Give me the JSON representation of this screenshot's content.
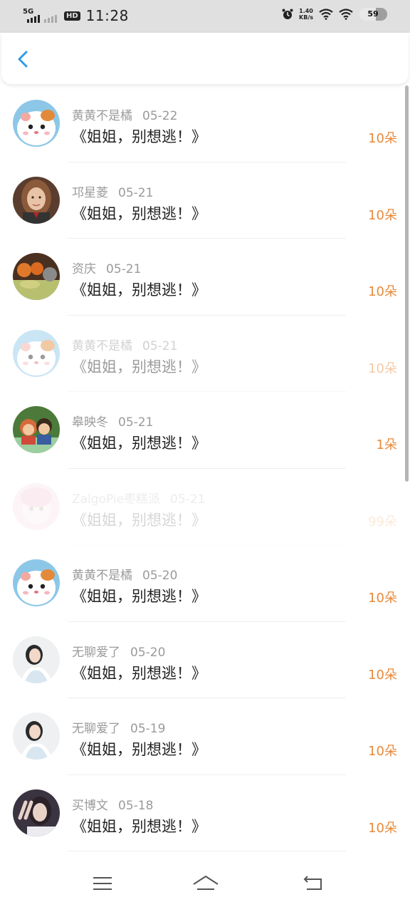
{
  "status_bar": {
    "network": "5G",
    "hd": "HD",
    "time": "11:28",
    "speed_value": "1.40",
    "speed_unit": "KB/s",
    "battery": "59",
    "battery_level": 0.59
  },
  "header": {
    "back_icon": "chevron-left-icon",
    "accent": "#2f9be8"
  },
  "records": [
    {
      "user": "黄黄不是橘",
      "date": "05-22",
      "title": "《姐姐，别想逃！》",
      "flowers": "10朵",
      "avatar": "hamster"
    },
    {
      "user": "邛星菱",
      "date": "05-21",
      "title": "《姐姐，别想逃！》",
      "flowers": "10朵",
      "avatar": "girl-brown-hair"
    },
    {
      "user": "资庆",
      "date": "05-21",
      "title": "《姐姐，别想逃！》",
      "flowers": "10朵",
      "avatar": "food-table"
    },
    {
      "user": "黄黄不是橘",
      "date": "05-21",
      "title": "《姐姐，别想逃！》",
      "flowers": "10朵",
      "avatar": "hamster"
    },
    {
      "user": "皋映冬",
      "date": "05-21",
      "title": "《姐姐，别想逃！》",
      "flowers": "1朵",
      "avatar": "cartoon-kids"
    },
    {
      "user": "ZalgoPie枣糕派",
      "date": "05-21",
      "title": "《姐姐，别想逃！》",
      "flowers": "99朵",
      "avatar": "pink-character"
    },
    {
      "user": "黄黄不是橘",
      "date": "05-20",
      "title": "《姐姐，别想逃！》",
      "flowers": "10朵",
      "avatar": "hamster"
    },
    {
      "user": "无聊爱了",
      "date": "05-20",
      "title": "《姐姐，别想逃！》",
      "flowers": "10朵",
      "avatar": "girl-white-dress"
    },
    {
      "user": "无聊爱了",
      "date": "05-19",
      "title": "《姐姐，别想逃！》",
      "flowers": "10朵",
      "avatar": "girl-white-dress"
    },
    {
      "user": "买博文",
      "date": "05-18",
      "title": "《姐姐，别想逃！》",
      "flowers": "10朵",
      "avatar": "person-peace-sign"
    }
  ],
  "colors": {
    "flowers": "#e8893a",
    "username": "#9a9a9a",
    "title": "#222222"
  },
  "nav": {
    "menu_icon": "menu-icon",
    "home_icon": "home-icon",
    "back_icon": "back-arrow-icon"
  }
}
